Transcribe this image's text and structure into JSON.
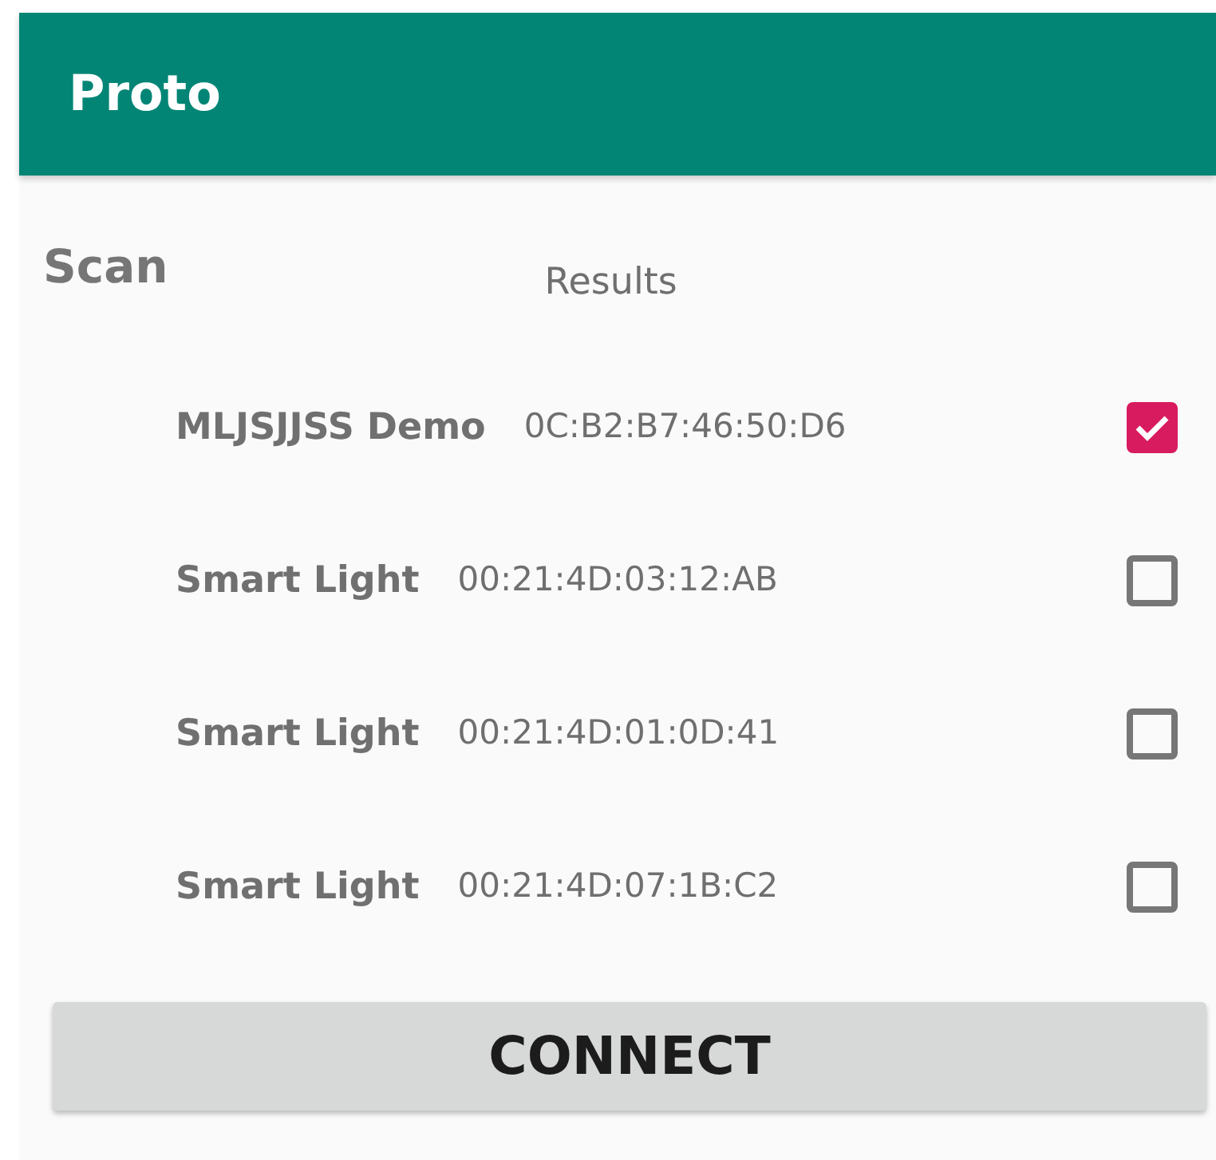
{
  "app_bar": {
    "title": "Proto"
  },
  "scan_label": "Scan",
  "results_label": "Results",
  "devices": [
    {
      "name": "MLJSJJSS Demo",
      "address": "0C:B2:B7:46:50:D6",
      "checked": true
    },
    {
      "name": "Smart Light",
      "address": "00:21:4D:03:12:AB",
      "checked": false
    },
    {
      "name": "Smart Light",
      "address": "00:21:4D:01:0D:41",
      "checked": false
    },
    {
      "name": "Smart Light",
      "address": "00:21:4D:07:1B:C2",
      "checked": false
    }
  ],
  "connect_button": "CONNECT"
}
